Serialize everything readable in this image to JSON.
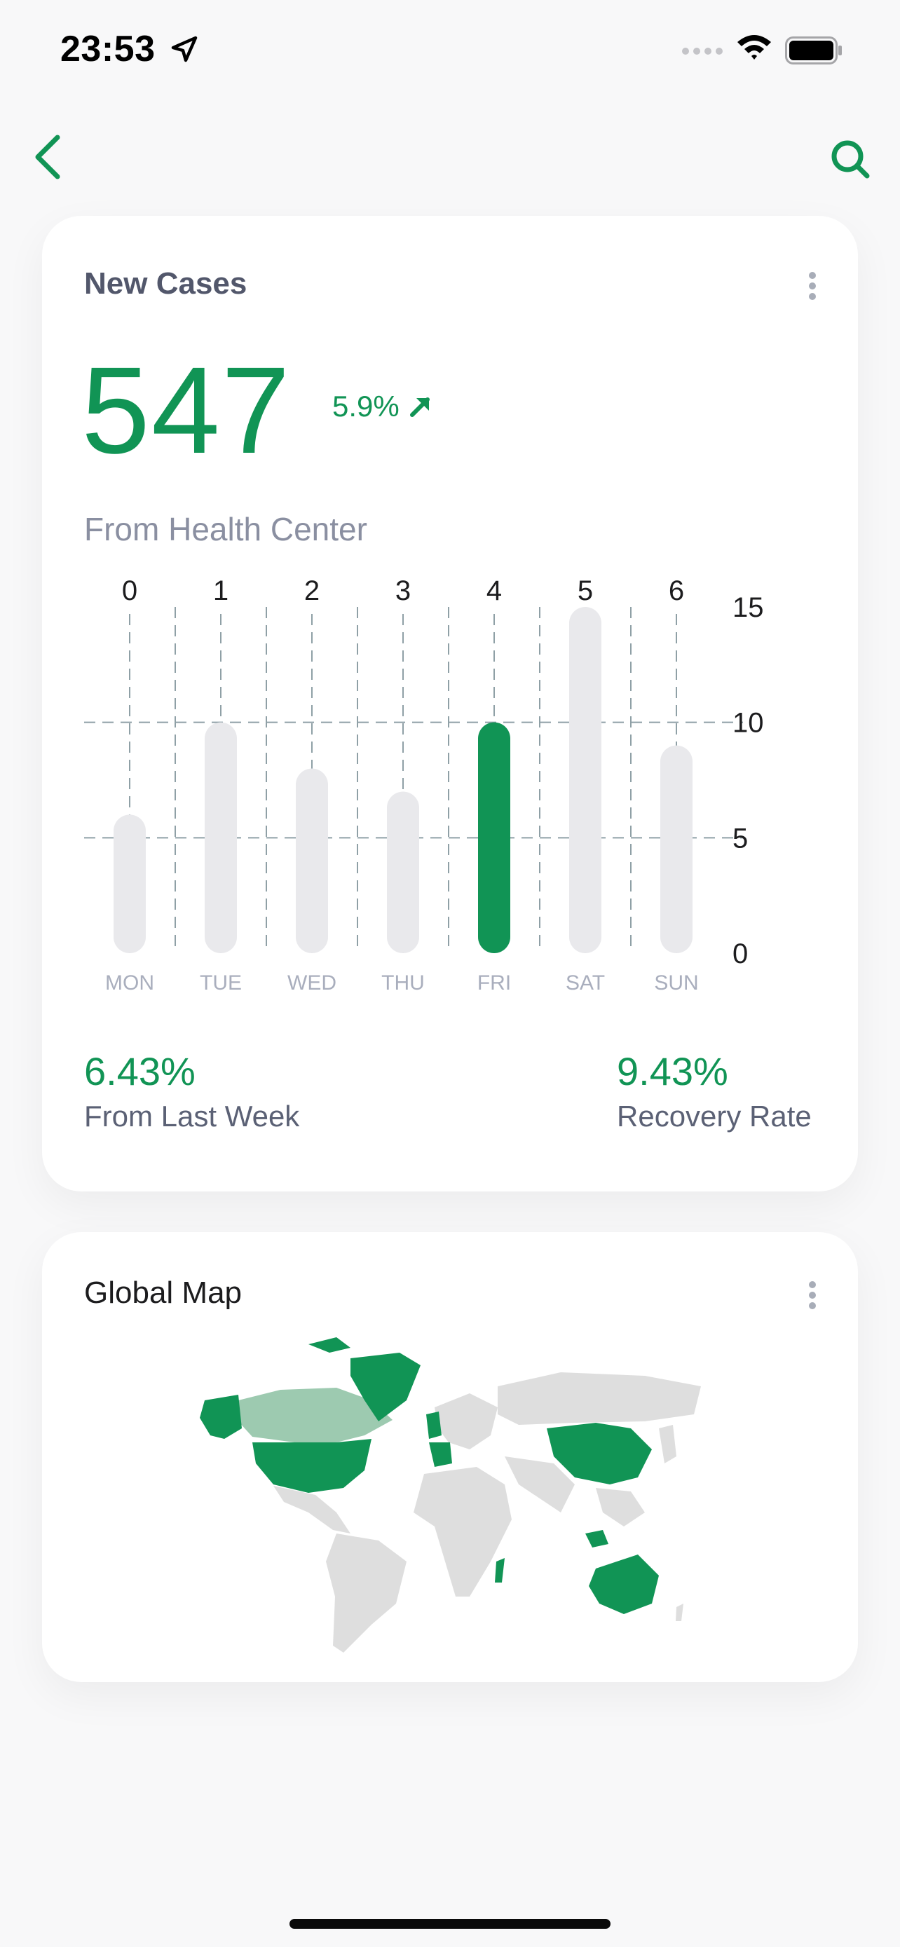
{
  "status_bar": {
    "time": "23:53"
  },
  "cases_card": {
    "title": "New Cases",
    "total": "547",
    "change": "5.9%",
    "source": "From Health Center",
    "stat_left": {
      "value": "6.43%",
      "label": "From Last Week"
    },
    "stat_right": {
      "value": "9.43%",
      "label": "Recovery Rate"
    }
  },
  "map_card": {
    "title": "Global Map"
  },
  "colors": {
    "accent": "#119455",
    "bar_inactive": "#e9e9ec",
    "map_land": "#dedede",
    "map_light": "#9dcab0"
  },
  "chart_data": {
    "type": "bar",
    "categories": [
      "MON",
      "TUE",
      "WED",
      "THU",
      "FRI",
      "SAT",
      "SUN"
    ],
    "top_ticks": [
      "0",
      "1",
      "2",
      "3",
      "4",
      "5",
      "6"
    ],
    "values": [
      6,
      10,
      8,
      7,
      10,
      15,
      9
    ],
    "highlight_index": 4,
    "ylim": [
      0,
      15
    ],
    "yticks": [
      "0",
      "5",
      "10",
      "15"
    ],
    "grid": true
  }
}
